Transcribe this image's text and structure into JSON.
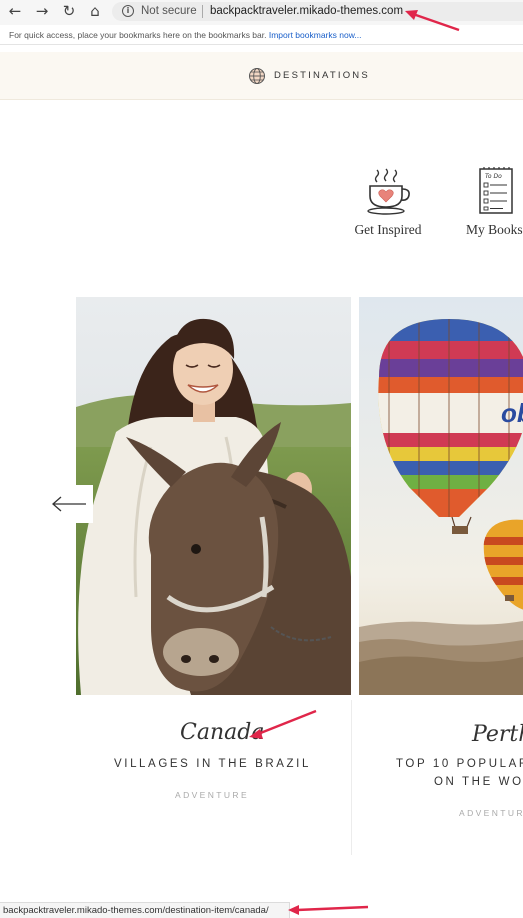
{
  "browser": {
    "back_icon": "arrow-left",
    "forward_icon": "arrow-right",
    "reload_icon": "reload",
    "home_icon": "home",
    "security_label": "Not secure",
    "url": "backpacktraveler.mikado-themes.com",
    "bookmarks_prompt": "For quick access, place your bookmarks here on the bookmarks bar.",
    "bookmarks_link": "Import bookmarks now...",
    "status_url": "backpacktraveler.mikado-themes.com/destination-item/canada/"
  },
  "header": {
    "nav_label": "DESTINATIONS"
  },
  "categories": [
    {
      "label": "Get Inspired",
      "icon": "coffee-cup-heart-icon"
    },
    {
      "label": "My Books",
      "icon": "todo-list-icon"
    }
  ],
  "cards": [
    {
      "script": "Canada",
      "title": "VILLAGES IN THE BRAZIL",
      "category": "ADVENTURE"
    },
    {
      "script": "Perth",
      "title_line1": "TOP 10 POPULAR",
      "title_line2": "ON THE WO",
      "category": "ADVENTUR"
    }
  ],
  "colors": {
    "annotation": "#e0264a",
    "header_bg": "#fbf8f2",
    "link": "#1a5fc9"
  }
}
